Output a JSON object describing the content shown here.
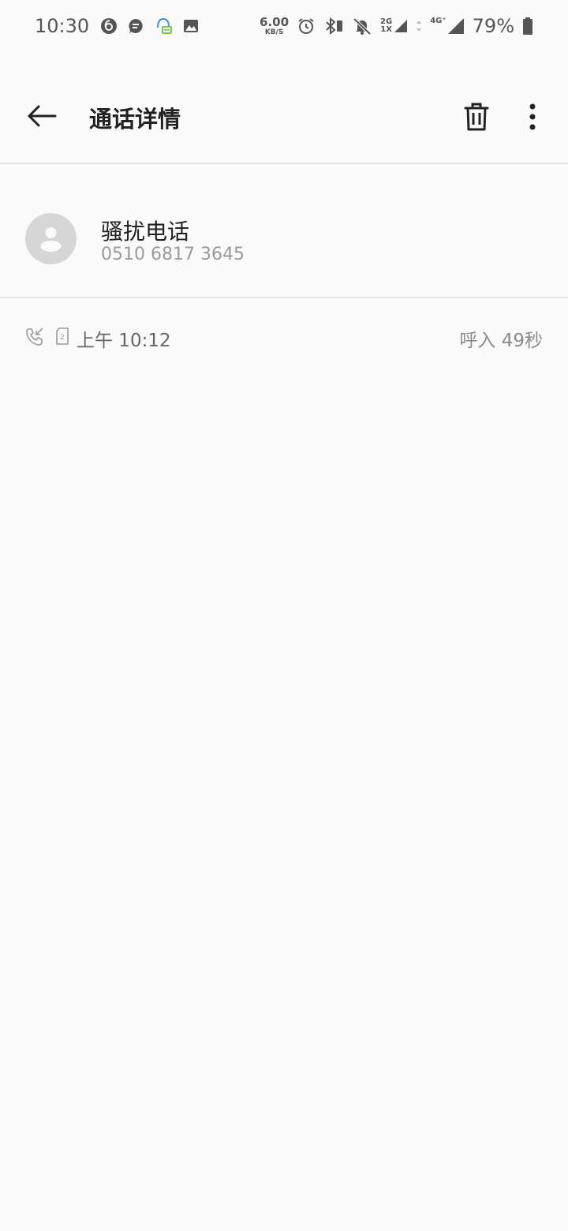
{
  "status_bar": {
    "time": "10:30",
    "net_speed_value": "6.00",
    "net_speed_unit": "KB/S",
    "sim1_label_top": "2G",
    "sim1_label_bottom": "1X",
    "sim2_label": "4G⁺",
    "battery": "79%"
  },
  "header": {
    "title": "通话详情"
  },
  "contact": {
    "name": "骚扰电话",
    "number": "0510 6817 3645"
  },
  "call_record": {
    "sim_slot": "2",
    "time": "上午 10:12",
    "info": "呼入 49秒"
  }
}
